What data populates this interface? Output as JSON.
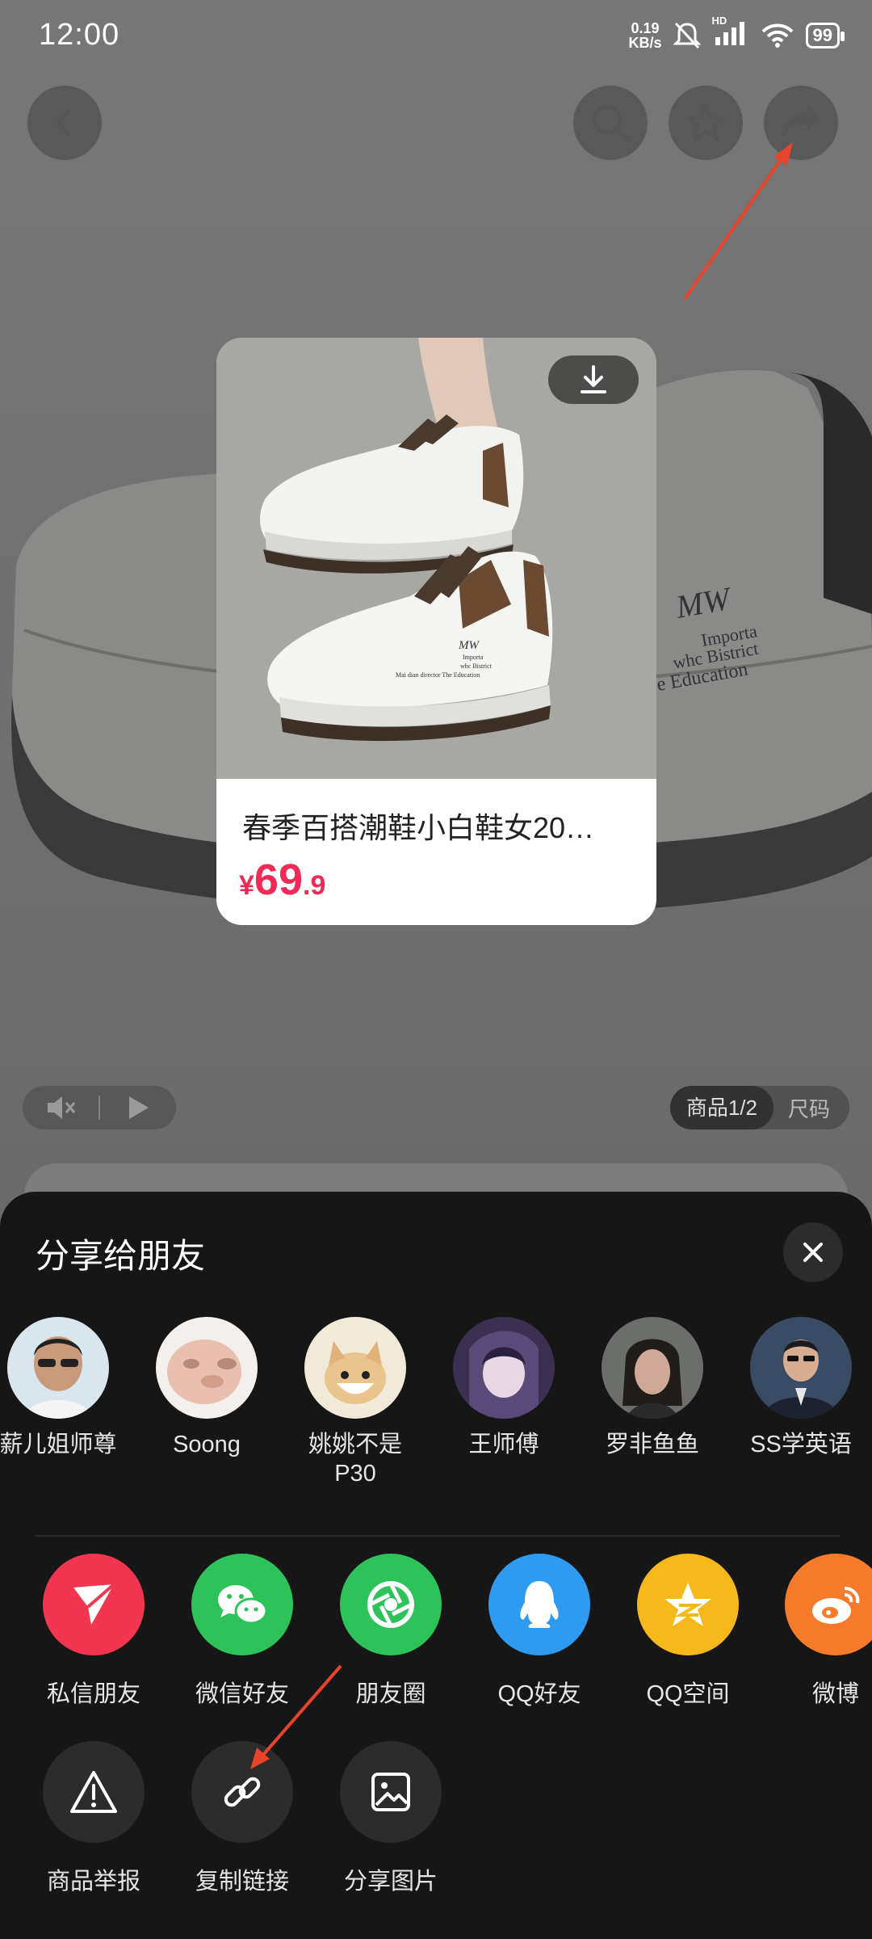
{
  "status_bar": {
    "time": "12:00",
    "net_speed_value": "0.19",
    "net_speed_unit": "KB/s",
    "hd_label": "HD",
    "battery": "99"
  },
  "top_bar": {
    "back_icon": "chevron-left-icon",
    "search_icon": "search-icon",
    "favorite_icon": "star-icon",
    "share_icon": "share-arrow-icon"
  },
  "product_card": {
    "title": "春季百搭潮鞋小白鞋女20…",
    "price_symbol": "¥",
    "price_integer": "69",
    "price_decimal": ".9",
    "download_icon": "download-icon",
    "shoe_print": [
      "MW",
      "Importa",
      "whc Bistrict",
      "Mai dian director The Education"
    ]
  },
  "background_shoe_print": [
    "MW",
    "Importa",
    "whc Bistrict",
    "e Education"
  ],
  "media_controls": {
    "mute_icon": "speaker-muted-icon",
    "play_icon": "play-icon"
  },
  "pager": {
    "active_label": "商品1/2",
    "size_label": "尺码"
  },
  "share_sheet": {
    "title": "分享给朋友",
    "close_icon": "close-icon",
    "friends": [
      {
        "name": "薪儿姐师尊"
      },
      {
        "name": "Soong"
      },
      {
        "name": "姚姚不是P30"
      },
      {
        "name": "王师傅"
      },
      {
        "name": "罗非鱼鱼"
      },
      {
        "name": "SS学英语"
      }
    ],
    "apps": [
      {
        "label": "私信朋友",
        "icon": "paper-plane-icon",
        "color": "#f2364f"
      },
      {
        "label": "微信好友",
        "icon": "wechat-icon",
        "color": "#2dc35a"
      },
      {
        "label": "朋友圈",
        "icon": "moments-shutter-icon",
        "color": "#2dc35a"
      },
      {
        "label": "QQ好友",
        "icon": "qq-penguin-icon",
        "color": "#2f9bf0"
      },
      {
        "label": "QQ空间",
        "icon": "qzone-star-icon",
        "color": "#f7b81c"
      },
      {
        "label": "微博",
        "icon": "weibo-icon",
        "color": "#f57b2a"
      }
    ],
    "actions": [
      {
        "label": "商品举报",
        "icon": "warning-icon"
      },
      {
        "label": "复制链接",
        "icon": "link-icon"
      },
      {
        "label": "分享图片",
        "icon": "image-icon"
      }
    ]
  },
  "colors": {
    "price_red": "#f02a56",
    "sheet_bg": "#161616",
    "annotation_arrow": "#e8432b"
  }
}
